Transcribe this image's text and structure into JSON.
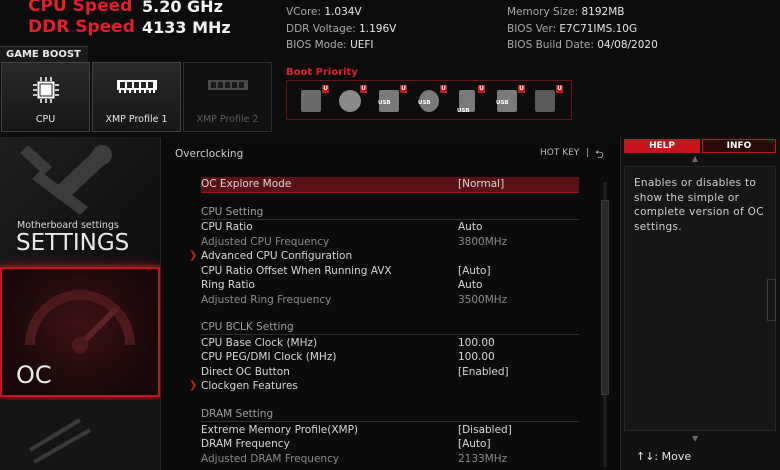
{
  "header": {
    "cpu_speed_label": "CPU Speed",
    "cpu_speed_value": "5.20 GHz",
    "ddr_speed_label": "DDR Speed",
    "ddr_speed_value": "4133 MHz",
    "info_left": [
      {
        "k": "VCore:",
        "v": "1.034V"
      },
      {
        "k": "DDR Voltage:",
        "v": "1.196V"
      },
      {
        "k": "BIOS Mode:",
        "v": "UEFI"
      }
    ],
    "info_right": [
      {
        "k": "Memory Size:",
        "v": "8192MB"
      },
      {
        "k": "BIOS Ver:",
        "v": "E7C71IMS.10G"
      },
      {
        "k": "BIOS Build Date:",
        "v": "04/08/2020"
      }
    ]
  },
  "game_boost": {
    "label": "GAME BOOST",
    "buttons": [
      {
        "label": "CPU",
        "icon": "cpu-icon",
        "state": "active"
      },
      {
        "label": "XMP Profile 1",
        "icon": "ram-icon",
        "state": "active"
      },
      {
        "label": "XMP Profile 2",
        "icon": "ram-icon",
        "state": "disabled"
      }
    ]
  },
  "boot_priority": {
    "title": "Boot Priority",
    "devices": [
      {
        "icon": "hdd-icon",
        "badge": "U",
        "text": ""
      },
      {
        "icon": "optical-disc-icon",
        "badge": "U",
        "text": ""
      },
      {
        "icon": "usb-drive-icon",
        "badge": "U",
        "text": "USB"
      },
      {
        "icon": "usb-disc-icon",
        "badge": "U",
        "text": "USB"
      },
      {
        "icon": "usb-key-icon",
        "badge": "U",
        "text": "USB"
      },
      {
        "icon": "usb-floppy-icon",
        "badge": "U",
        "text": "USB"
      },
      {
        "icon": "network-icon",
        "badge": "U",
        "text": ""
      }
    ]
  },
  "sidebar": {
    "settings_sub": "Motherboard settings",
    "settings_main": "SETTINGS",
    "oc_main": "OC"
  },
  "main": {
    "title": "Overclocking",
    "hotkey_label": "HOT KEY",
    "hotkey_sep": "|",
    "rows": [
      {
        "name": "OC Explore Mode",
        "value": "[Normal]",
        "selected": true
      },
      {
        "section": "CPU Setting"
      },
      {
        "name": "CPU Ratio",
        "value": "Auto"
      },
      {
        "name": "Adjusted CPU Frequency",
        "value": "3800MHz",
        "dim": true
      },
      {
        "name": "Advanced CPU Configuration",
        "value": "",
        "submenu": true
      },
      {
        "name": "CPU Ratio Offset When Running AVX",
        "value": "[Auto]"
      },
      {
        "name": "Ring Ratio",
        "value": "Auto"
      },
      {
        "name": "Adjusted Ring Frequency",
        "value": "3500MHz",
        "dim": true
      },
      {
        "section": "CPU BCLK Setting"
      },
      {
        "name": "CPU Base Clock (MHz)",
        "value": "100.00"
      },
      {
        "name": "CPU PEG/DMI Clock (MHz)",
        "value": "100.00"
      },
      {
        "name": "Direct OC Button",
        "value": "[Enabled]"
      },
      {
        "name": "Clockgen Features",
        "value": "",
        "submenu": true
      },
      {
        "section": "DRAM Setting"
      },
      {
        "name": "Extreme Memory Profile(XMP)",
        "value": "[Disabled]"
      },
      {
        "name": "DRAM Frequency",
        "value": "[Auto]"
      },
      {
        "name": "Adjusted DRAM Frequency",
        "value": "2133MHz",
        "dim": true
      }
    ]
  },
  "help": {
    "tab_help": "HELP",
    "tab_info": "INFO",
    "text": "Enables or disables to show the simple or complete version of OC settings.",
    "footer_keys": "↑↓: Move"
  },
  "colors": {
    "accent_red": "#c8151d",
    "selected_row": "#5a1215"
  }
}
